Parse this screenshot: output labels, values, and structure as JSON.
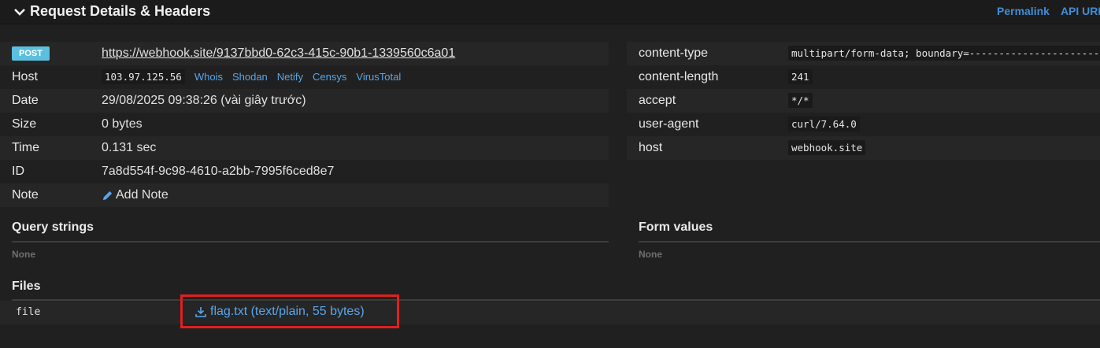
{
  "header": {
    "title": "Request Details & Headers",
    "links": [
      "Permalink",
      "API URL"
    ]
  },
  "request": {
    "method": "POST",
    "url": "https://webhook.site/9137bbd0-62c3-415c-90b1-1339560c6a01",
    "host_label": "Host",
    "host_ip": "103.97.125.56",
    "host_services": [
      "Whois",
      "Shodan",
      "Netify",
      "Censys",
      "VirusTotal"
    ],
    "date_label": "Date",
    "date": "29/08/2025 09:38:26 (vài giây trước)",
    "size_label": "Size",
    "size": "0 bytes",
    "time_label": "Time",
    "time": "0.131 sec",
    "id_label": "ID",
    "id": "7a8d554f-9c98-4610-a2bb-7995f6ced8e7",
    "note_label": "Note",
    "add_note": "Add Note"
  },
  "headers": [
    {
      "name": "content-type",
      "value": "multipart/form-data; boundary=------------------------"
    },
    {
      "name": "content-length",
      "value": "241"
    },
    {
      "name": "accept",
      "value": "*/*"
    },
    {
      "name": "user-agent",
      "value": "curl/7.64.0"
    },
    {
      "name": "host",
      "value": "webhook.site"
    }
  ],
  "query_strings": {
    "title": "Query strings",
    "value": "None"
  },
  "form_values": {
    "title": "Form values",
    "value": "None"
  },
  "files": {
    "title": "Files",
    "items": [
      {
        "key": "file",
        "link": "flag.txt (text/plain, 55 bytes)"
      }
    ]
  },
  "colors": {
    "accent": "#5aa5ea",
    "badge": "#5bc0de",
    "highlight": "#e02020"
  }
}
